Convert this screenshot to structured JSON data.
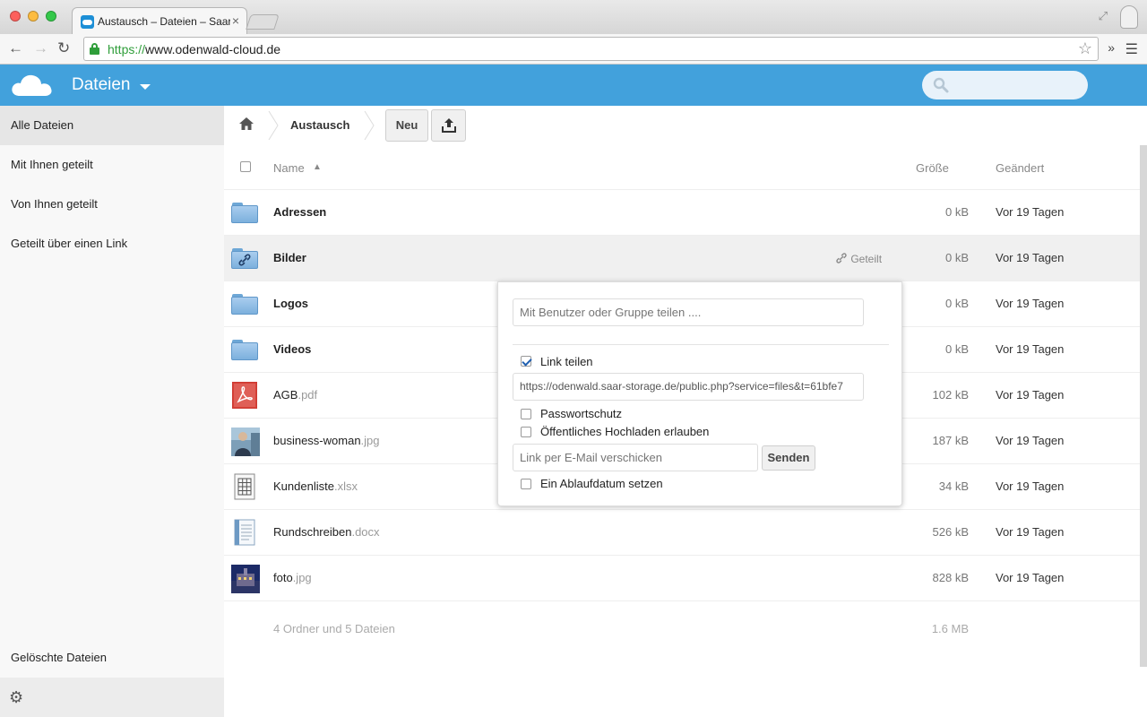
{
  "browser": {
    "tab_title": "Austausch – Dateien – Saar",
    "tab_close": "×",
    "url_scheme": "https://",
    "url_rest": "www.odenwald-cloud.de",
    "ext_label": "»"
  },
  "header": {
    "app_title": "Dateien",
    "search_placeholder": ""
  },
  "sidebar": {
    "items": [
      {
        "label": "Alle Dateien"
      },
      {
        "label": "Mit Ihnen geteilt"
      },
      {
        "label": "Von Ihnen geteilt"
      },
      {
        "label": "Geteilt über einen Link"
      }
    ],
    "deleted_label": "Gelöschte Dateien"
  },
  "controls": {
    "breadcrumb": "Austausch",
    "new_button": "Neu"
  },
  "table": {
    "col_name": "Name",
    "col_size": "Größe",
    "col_modified": "Geändert",
    "sort_indicator": "▲",
    "rows": [
      {
        "name": "Adressen",
        "ext": "",
        "size": "0 kB",
        "modified": "Vor 19 Tagen",
        "type": "folder"
      },
      {
        "name": "Bilder",
        "ext": "",
        "size": "0 kB",
        "modified": "Vor 19 Tagen",
        "type": "folder-shared",
        "shared_label": "Geteilt"
      },
      {
        "name": "Logos",
        "ext": "",
        "size": "0 kB",
        "modified": "Vor 19 Tagen",
        "type": "folder"
      },
      {
        "name": "Videos",
        "ext": "",
        "size": "0 kB",
        "modified": "Vor 19 Tagen",
        "type": "folder"
      },
      {
        "name": "AGB",
        "ext": ".pdf",
        "size": "102 kB",
        "modified": "Vor 19 Tagen",
        "type": "pdf"
      },
      {
        "name": "business-woman",
        "ext": ".jpg",
        "size": "187 kB",
        "modified": "Vor 19 Tagen",
        "type": "image"
      },
      {
        "name": "Kundenliste",
        "ext": ".xlsx",
        "size": "34 kB",
        "modified": "Vor 19 Tagen",
        "type": "spreadsheet"
      },
      {
        "name": "Rundschreiben",
        "ext": ".docx",
        "size": "526 kB",
        "modified": "Vor 19 Tagen",
        "type": "document"
      },
      {
        "name": "foto",
        "ext": ".jpg",
        "size": "828 kB",
        "modified": "Vor 19 Tagen",
        "type": "photo"
      }
    ],
    "summary_text": "4 Ordner und 5 Dateien",
    "summary_size": "1.6 MB"
  },
  "share": {
    "user_placeholder": "Mit Benutzer oder Gruppe teilen ....",
    "link_share_label": "Link teilen",
    "link_share_checked": true,
    "link_url": "https://odenwald.saar-storage.de/public.php?service=files&t=61bfe7",
    "password_label": "Passwortschutz",
    "public_upload_label": "Öffentliches Hochladen erlauben",
    "email_placeholder": "Link per E-Mail verschicken",
    "send_label": "Senden",
    "expire_label": "Ein Ablaufdatum setzen"
  },
  "colors": {
    "header": "#42a1dc",
    "sidebar": "#f8f8f8",
    "secure_green": "#2f9e3a"
  }
}
